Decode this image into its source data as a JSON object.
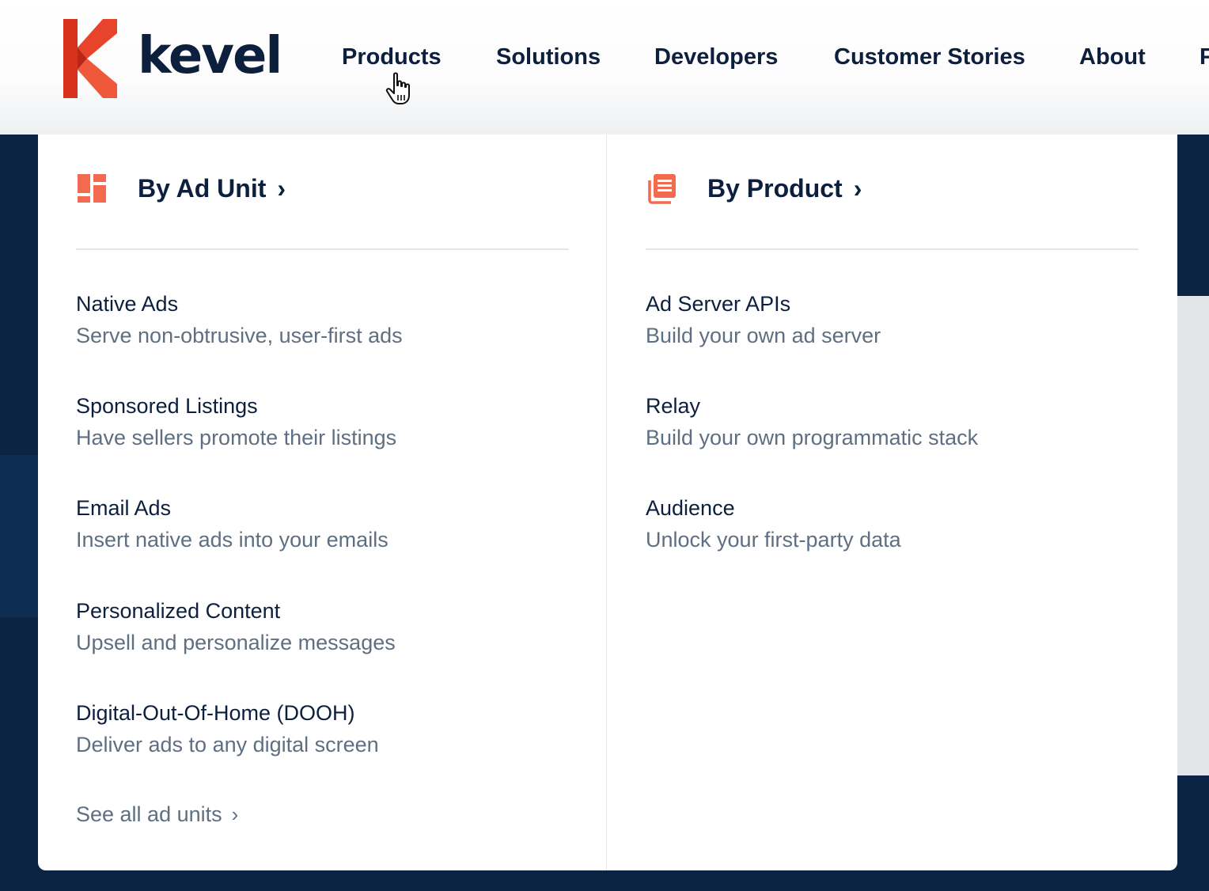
{
  "brand": {
    "name": "kevel",
    "accent_color": "#e8442c"
  },
  "nav": {
    "items": [
      {
        "label": "Products"
      },
      {
        "label": "Solutions"
      },
      {
        "label": "Developers"
      },
      {
        "label": "Customer Stories"
      },
      {
        "label": "About"
      },
      {
        "label": "F"
      }
    ]
  },
  "dropdown": {
    "by_ad_unit": {
      "heading": "By Ad Unit",
      "chevron": "›",
      "icon": "layout-grid-icon",
      "items": [
        {
          "title": "Native Ads",
          "desc": "Serve non-obtrusive, user-first ads"
        },
        {
          "title": "Sponsored Listings",
          "desc": "Have sellers promote their listings"
        },
        {
          "title": "Email Ads",
          "desc": "Insert native ads into your emails"
        },
        {
          "title": "Personalized Content",
          "desc": "Upsell and personalize messages"
        },
        {
          "title": "Digital-Out-Of-Home (DOOH)",
          "desc": "Deliver ads to any digital screen"
        }
      ],
      "see_all": "See all ad units",
      "see_all_chevron": "›"
    },
    "by_product": {
      "heading": "By Product",
      "chevron": "›",
      "icon": "documents-icon",
      "items": [
        {
          "title": "Ad Server APIs",
          "desc": "Build your own ad server"
        },
        {
          "title": "Relay",
          "desc": "Build your own programmatic stack"
        },
        {
          "title": "Audience",
          "desc": "Unlock your first-party data"
        }
      ]
    }
  },
  "colors": {
    "navy": "#0c1f3d",
    "muted": "#5f6f82",
    "icon_orange": "#f26a4f"
  }
}
